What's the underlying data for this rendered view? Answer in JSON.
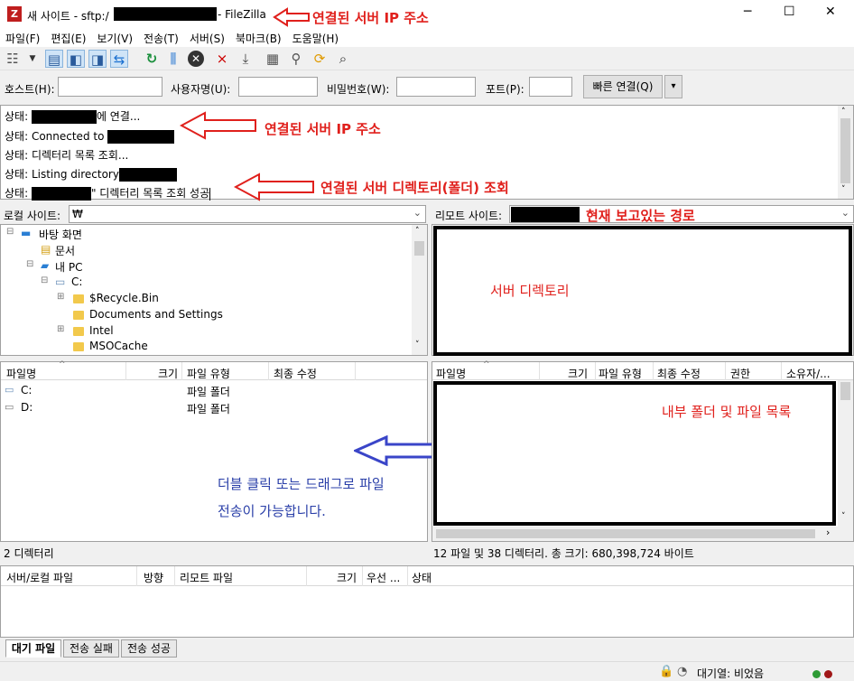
{
  "window": {
    "title_prefix": "새 사이트 - sftp:/",
    "title_suffix": "- FileZilla",
    "app_icon": "filezilla-icon",
    "controls": {
      "minimize": "─",
      "maximize": "☐",
      "close": "✕"
    }
  },
  "menu": [
    "파일(F)",
    "편집(E)",
    "보기(V)",
    "전송(T)",
    "서버(S)",
    "북마크(B)",
    "도움말(H)"
  ],
  "quickconnect": {
    "host_label": "호스트(H):",
    "user_label": "사용자명(U):",
    "pass_label": "비밀번호(W):",
    "port_label": "포트(P):",
    "connect_button": "빠른 연결(Q)",
    "dropdown_icon": "▾"
  },
  "log": {
    "lines": [
      "상태:",
      "상태:  Connected to",
      "상태:  디렉터리 목록 조회...",
      "상태:  Listing directory",
      "상태:"
    ],
    "line1_suffix": "에 연결...",
    "line5_suffix": "\" 디렉터리 목록 조회 성공"
  },
  "local": {
    "site_label": "로컬 사이트:",
    "site_value": "₩",
    "tree": [
      "바탕 화면",
      "문서",
      "내 PC",
      "C:",
      "$Recycle.Bin",
      "Documents and Settings",
      "Intel",
      "MSOCache"
    ],
    "columns": [
      "파일명",
      "크기",
      "파일 유형",
      "최종 수정"
    ],
    "rows": [
      {
        "name": "C:",
        "type": "파일 폴더"
      },
      {
        "name": "D:",
        "type": "파일 폴더"
      }
    ],
    "status": "2 디렉터리"
  },
  "remote": {
    "site_label": "리모트 사이트:",
    "columns": [
      "파일명",
      "크기",
      "파일 유형",
      "최종 수정",
      "권한",
      "소유자/..."
    ],
    "status": "12 파일 및 38 디렉터리. 총 크기: 680,398,724 바이트"
  },
  "queue": {
    "columns": [
      "서버/로컬 파일",
      "방향",
      "리모트 파일",
      "크기",
      "우선 ...",
      "상태"
    ],
    "tabs": [
      "대기 파일",
      "전송 실패",
      "전송 성공"
    ],
    "status_text": "대기열: 비었음"
  },
  "annotations": {
    "title_ip": "연결된 서버 IP 주소",
    "log_ip": "연결된 서버 IP 주소",
    "log_dir": "연결된 서버 디렉토리(폴더) 조회",
    "current_path": "현재 보고있는 경로",
    "server_dir": "서버 디렉토리",
    "file_list": "내부 폴더 및 파일 목록",
    "transfer_line1": "더블 클릭 또는 드래그로 파일",
    "transfer_line2": "전송이 가능합니다."
  },
  "colors": {
    "annotation_red": "#e0201c",
    "annotation_blue": "#2a3fa8",
    "arrow_blue": "#3a45c8"
  }
}
